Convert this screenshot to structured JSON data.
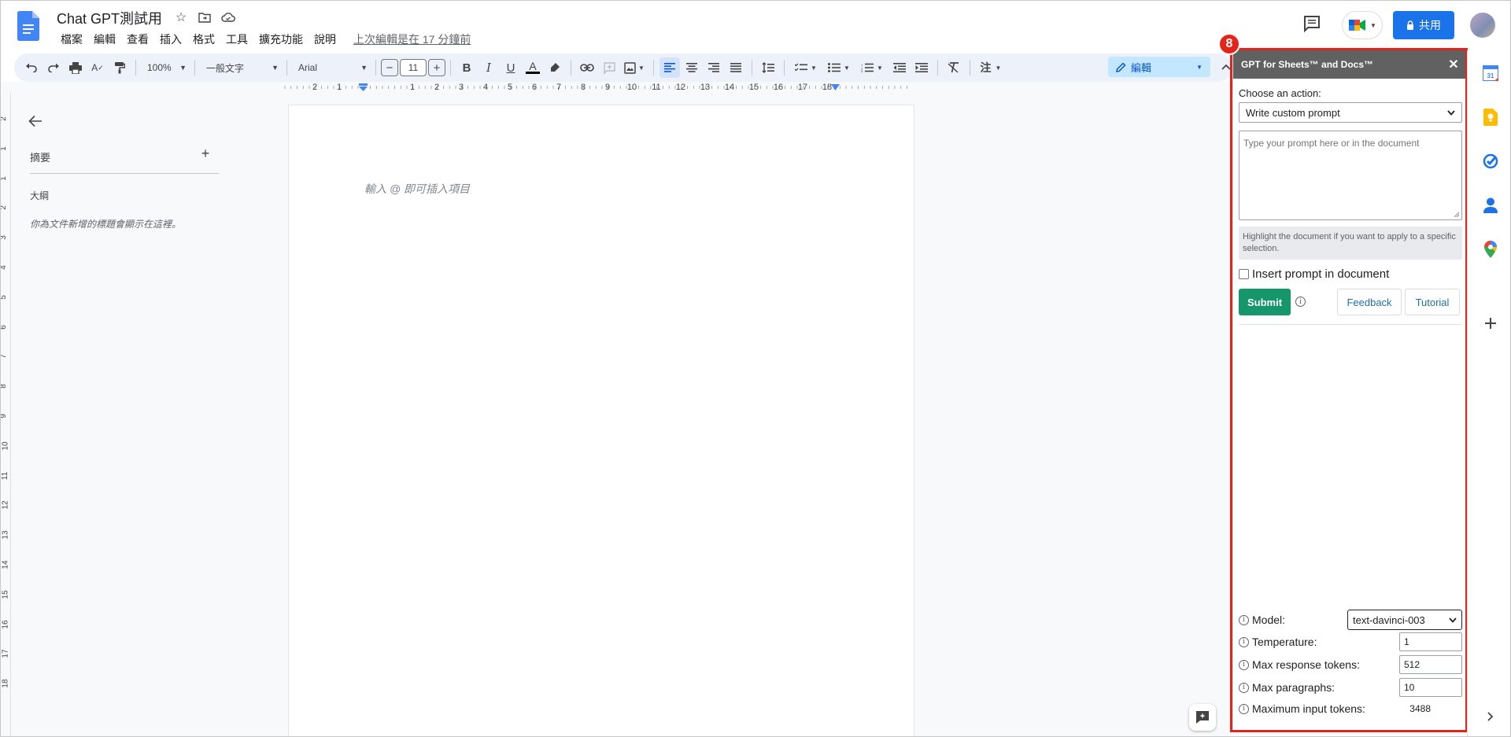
{
  "header": {
    "title": "Chat GPT測試用",
    "menu": [
      "檔案",
      "編輯",
      "查看",
      "插入",
      "格式",
      "工具",
      "擴充功能",
      "說明"
    ],
    "last_edit": "上次編輯是在 17 分鐘前",
    "share_label": "共用",
    "brand_color": "#1a73e8"
  },
  "toolbar": {
    "zoom": "100%",
    "style": "一般文字",
    "font": "Arial",
    "font_size": "11",
    "mode": "編輯"
  },
  "ruler": {
    "h_ticks": [
      "2",
      "1",
      "1",
      "2",
      "3",
      "4",
      "5",
      "6",
      "7",
      "8",
      "9",
      "10",
      "11",
      "12",
      "13",
      "14",
      "15",
      "16",
      "17",
      "18"
    ],
    "v_ticks": [
      "2",
      "1",
      "1",
      "2",
      "3",
      "4",
      "5",
      "6",
      "7",
      "8",
      "9",
      "10",
      "11",
      "12",
      "13",
      "14",
      "15",
      "16",
      "17",
      "18"
    ]
  },
  "outline": {
    "summary_label": "摘要",
    "outline_label": "大綱",
    "hint": "你為文件新增的標題會顯示在這裡。"
  },
  "document": {
    "placeholder": "輸入 @ 即可插入項目"
  },
  "addon": {
    "badge": "8",
    "title": "GPT for Sheets™ and Docs™",
    "choose_label": "Choose an action:",
    "action_value": "Write custom prompt",
    "prompt_placeholder": "Type your prompt here or in the document",
    "highlight_note": "Highlight the document if you want to apply to a specific selection.",
    "insert_label": "Insert prompt in document",
    "submit_label": "Submit",
    "feedback_label": "Feedback",
    "tutorial_label": "Tutorial",
    "settings": {
      "model_label": "Model:",
      "model_value": "text-davinci-003",
      "temperature_label": "Temperature:",
      "temperature_value": "1",
      "max_tokens_label": "Max response tokens:",
      "max_tokens_value": "512",
      "max_paragraphs_label": "Max paragraphs:",
      "max_paragraphs_value": "10",
      "max_input_label": "Maximum input tokens:",
      "max_input_value": "3488"
    },
    "highlight_color": "#e3241b",
    "submit_color": "#16966b"
  },
  "sidepanel": {
    "icons": [
      "calendar-icon",
      "keep-icon",
      "tasks-icon",
      "contacts-icon",
      "maps-icon",
      "add-icon",
      "expand-icon"
    ],
    "calendar_day": "31"
  }
}
